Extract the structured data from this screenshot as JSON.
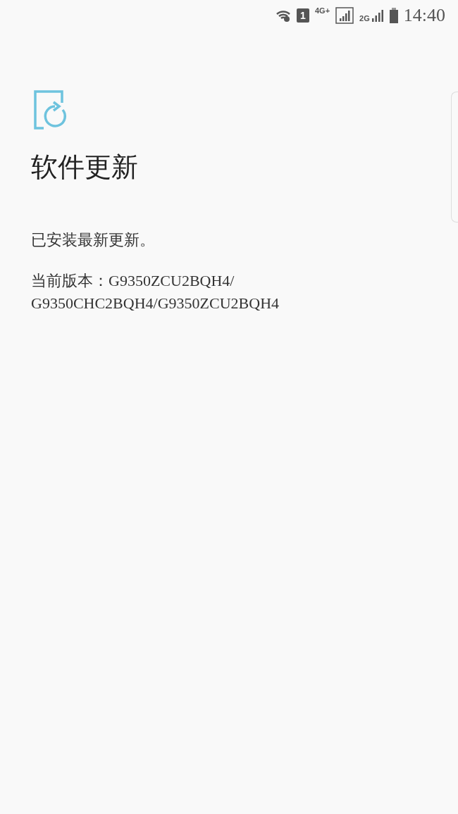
{
  "status_bar": {
    "sim_slot": "1",
    "network_primary": "4G+",
    "network_secondary": "2G",
    "time": "14:40"
  },
  "page": {
    "title": "软件更新",
    "message": "已安装最新更新。",
    "version_label": "当前版本：G9350ZCU2BQH4/",
    "version_value": "G9350CHC2BQH4/G9350ZCU2BQH4"
  }
}
